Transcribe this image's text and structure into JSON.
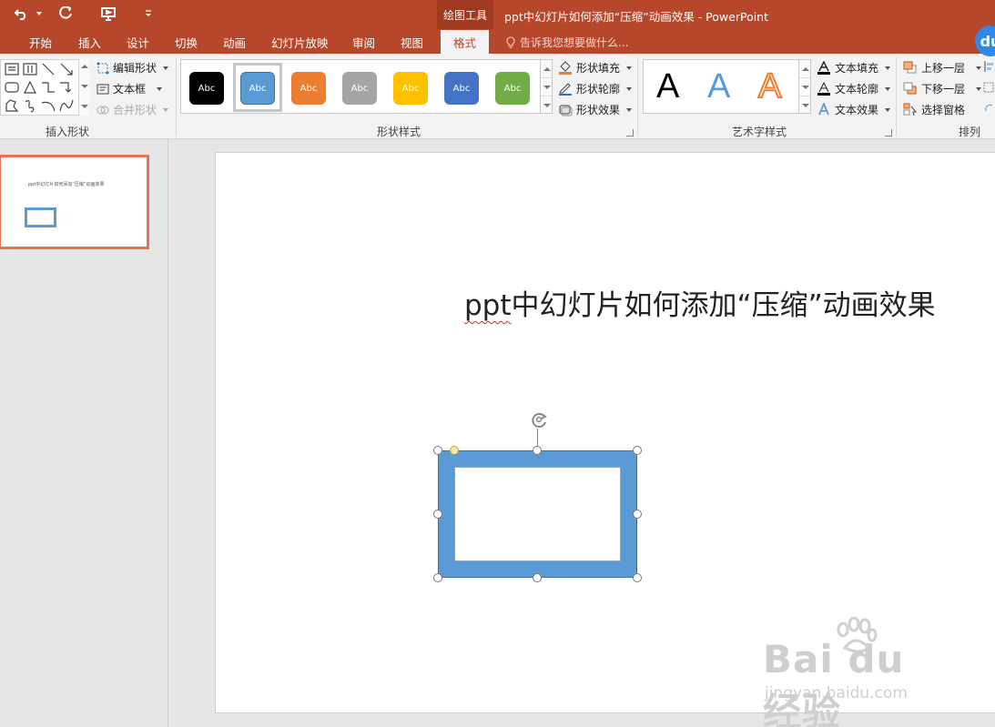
{
  "title_bar": {
    "context_tools": "绘图工具",
    "window_title": "ppt中幻灯片如何添加“压缩”动画效果 - PowerPoint",
    "accent_color": "#b7472a"
  },
  "tabs": [
    "开始",
    "插入",
    "设计",
    "切换",
    "动画",
    "幻灯片放映",
    "审阅",
    "视图",
    "格式"
  ],
  "tell_me": "告诉我您想要做什么...",
  "ribbon": {
    "insert_shapes": {
      "label": "插入形状",
      "edit_shape": "编辑形状",
      "text_box": "文本框",
      "merge_shapes": "合并形状"
    },
    "shape_styles": {
      "label": "形状样式",
      "sample_text": "Abc",
      "swatches": [
        "#000000",
        "#5b9bd5",
        "#ed7d31",
        "#a5a5a5",
        "#ffc000",
        "#4472c4",
        "#70ad47"
      ],
      "shape_fill": "形状填充",
      "shape_outline": "形状轮廓",
      "shape_effects": "形状效果"
    },
    "wordart_styles": {
      "label": "艺术字样式",
      "letter": "A",
      "text_fill": "文本填充",
      "text_outline": "文本轮廓",
      "text_effects": "文本效果"
    },
    "arrange": {
      "label": "排列",
      "bring_forward": "上移一层",
      "send_backward": "下移一层",
      "selection_pane": "选择窗格"
    }
  },
  "thumbnail": {
    "title": "ppt中幻灯片如何添加“压缩”动画效果"
  },
  "slide": {
    "title_ppt": "ppt",
    "title_rest": "中幻灯片如何添加“压缩”动画效果",
    "shape_color": "#5b9bd5"
  },
  "watermark": {
    "main": "Bai du 经验",
    "sub": "jingyan.baidu.com"
  },
  "du_logo": "du"
}
